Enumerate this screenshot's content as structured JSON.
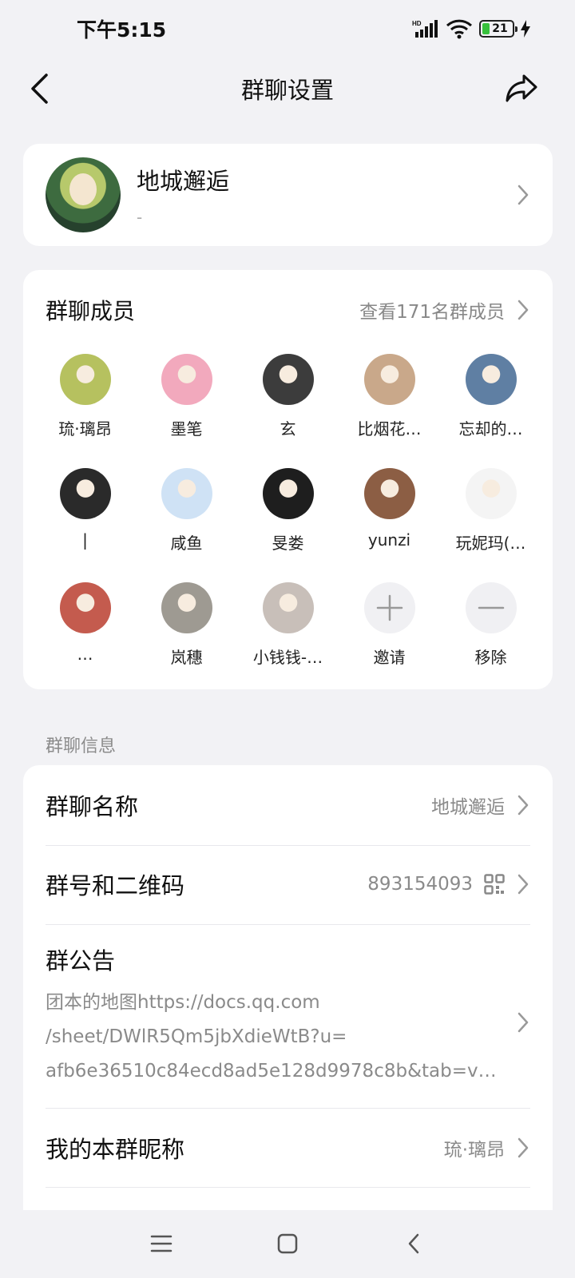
{
  "status_bar": {
    "time": "下午5:15",
    "battery": "21"
  },
  "nav": {
    "title": "群聊设置"
  },
  "group": {
    "name": "地城邂逅",
    "subtitle": "-"
  },
  "members": {
    "title": "群聊成员",
    "view_all": "查看171名群成员",
    "items": [
      {
        "name": "琉·璃昂",
        "color": "#b6c15f"
      },
      {
        "name": "墨笔",
        "color": "#f2a9bd"
      },
      {
        "name": "玄",
        "color": "#3c3c3c"
      },
      {
        "name": "比烟花…",
        "color": "#c9a88a"
      },
      {
        "name": "忘却的…",
        "color": "#5f7fa3"
      },
      {
        "name": "|",
        "color": "#2a2a2a"
      },
      {
        "name": "咸鱼",
        "color": "#cfe2f5"
      },
      {
        "name": "旻娄",
        "color": "#1e1e1e"
      },
      {
        "name": "yunzi",
        "color": "#8c5e44"
      },
      {
        "name": "玩妮玛(…",
        "color": "#f4f4f4"
      },
      {
        "name": "…",
        "color": "#c45b4e"
      },
      {
        "name": "岚穗",
        "color": "#9e9a92"
      },
      {
        "name": "小钱钱-…",
        "color": "#c8bfb9"
      }
    ],
    "invite": "邀请",
    "remove": "移除"
  },
  "info": {
    "section_label": "群聊信息",
    "name_label": "群聊名称",
    "name_value": "地城邂逅",
    "id_label": "群号和二维码",
    "id_value": "893154093",
    "notice_label": "群公告",
    "notice_lines": [
      "团本的地图https://docs.qq.com",
      "/sheet/DWlR5Qm5jbXdieWtB?u=",
      "afb6e36510c84ecd8ad5e128d9978c8b&tab=v…"
    ],
    "nickname_label": "我的本群昵称",
    "nickname_value": "琉·璃昂"
  }
}
